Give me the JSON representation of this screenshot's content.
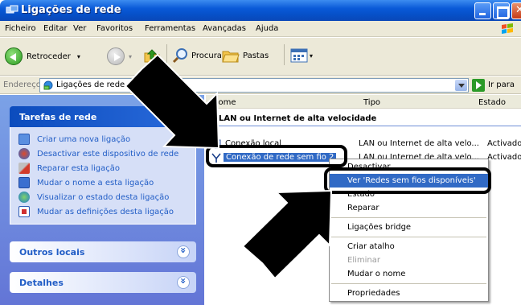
{
  "window": {
    "title": "Ligações de rede"
  },
  "menubar": {
    "items": [
      "Ficheiro",
      "Editar",
      "Ver",
      "Favoritos",
      "Ferramentas",
      "Avançadas",
      "Ajuda"
    ]
  },
  "toolbar": {
    "back_label": "Retroceder",
    "search_label": "Procurar",
    "folders_label": "Pastas"
  },
  "address": {
    "label": "Endereço",
    "value": "Ligações de rede",
    "go_label": "Ir para"
  },
  "sidebar": {
    "tasks_title": "Tarefas de rede",
    "tasks": [
      "Criar uma nova ligação",
      "Desactivar este dispositivo de rede",
      "Reparar esta ligação",
      "Mudar o nome a esta ligação",
      "Visualizar o estado desta ligação",
      "Mudar as definições desta ligação"
    ],
    "other_places_title": "Outros locais",
    "details_title": "Detalhes"
  },
  "content": {
    "columns": {
      "name": "Nome",
      "type": "Tipo",
      "status": "Estado"
    },
    "group_title": "LAN ou Internet de alta velocidade",
    "rows": [
      {
        "name": "Conexão local",
        "type": "LAN ou Internet de alta velo...",
        "status": "Activado"
      },
      {
        "name": "Conexão de rede sem fio 2",
        "type": "LAN ou Internet de alta velo...",
        "status": "Activado"
      }
    ]
  },
  "context_menu": {
    "items": [
      {
        "label": "Desactivar",
        "state": "normal"
      },
      {
        "label": "Ver 'Redes sem fios disponíveis'",
        "state": "highlighted"
      },
      {
        "label": "Estado",
        "state": "normal"
      },
      {
        "label": "Reparar",
        "state": "normal"
      },
      {
        "label": "Ligações bridge",
        "state": "normal"
      },
      {
        "label": "Criar atalho",
        "state": "normal"
      },
      {
        "label": "Eliminar",
        "state": "disabled"
      },
      {
        "label": "Mudar o nome",
        "state": "normal"
      },
      {
        "label": "Propriedades",
        "state": "normal"
      }
    ]
  },
  "colors": {
    "xp_blue": "#0a5ad8",
    "selection": "#316ac5",
    "task_link": "#215dc6",
    "annotation": "#000000"
  },
  "icons": {
    "back": "green-left-arrow-icon",
    "forward": "gray-right-arrow-icon",
    "up": "folder-up-icon",
    "search": "magnifier-icon",
    "folders": "folders-icon",
    "views": "views-icon",
    "network_connection": "network-icon",
    "wireless": "wireless-antenna-icon"
  }
}
